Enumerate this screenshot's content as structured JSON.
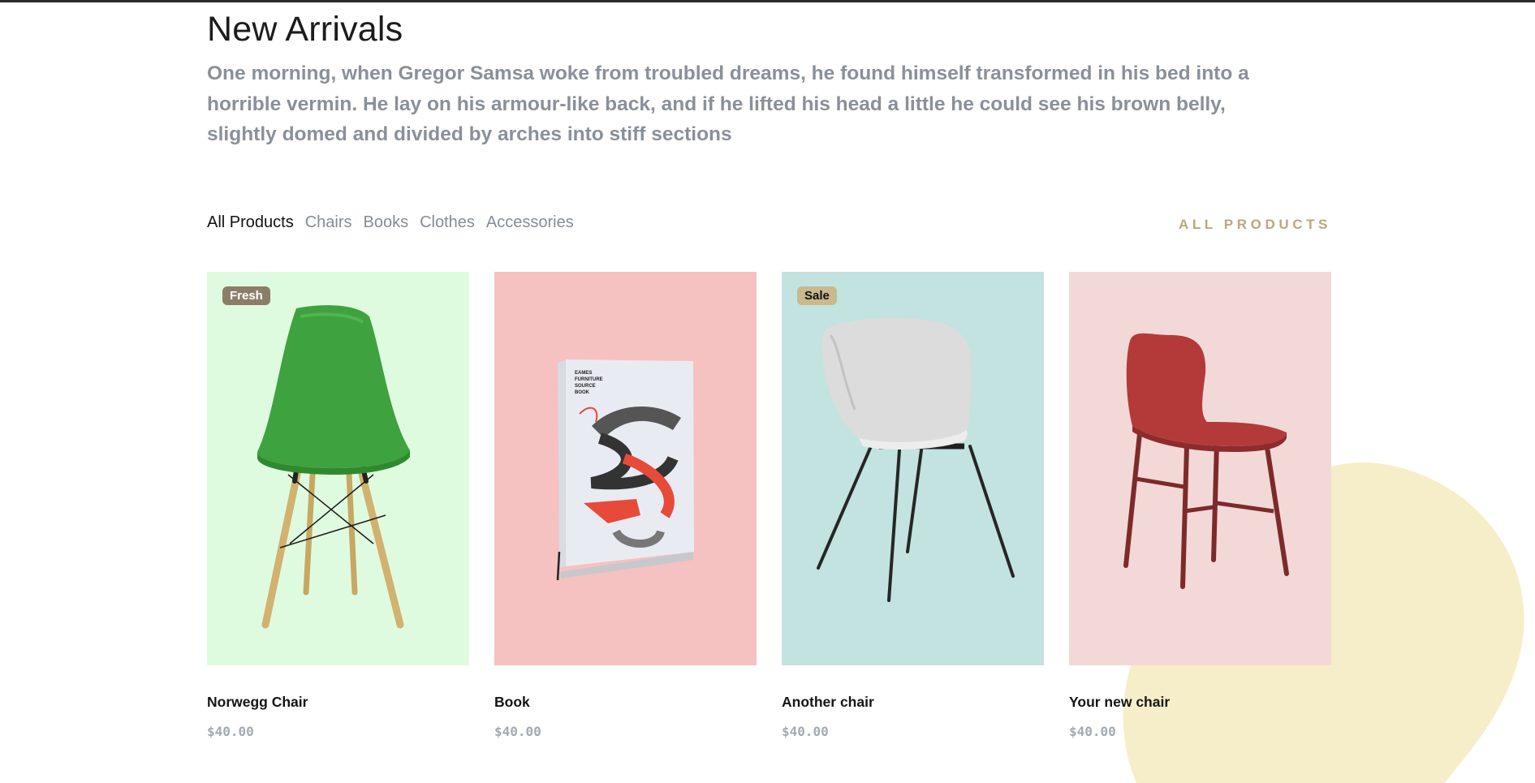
{
  "header": {
    "title": "New Arrivals",
    "description": "One morning, when Gregor Samsa woke from troubled dreams, he found himself transformed in his bed into a horrible vermin. He lay on his armour-like back, and if he lifted his head a little he could see his brown belly, slightly domed and divided by arches into stiff sections"
  },
  "filters": {
    "items": [
      {
        "label": "All Products",
        "active": true
      },
      {
        "label": "Chairs",
        "active": false
      },
      {
        "label": "Books",
        "active": false
      },
      {
        "label": "Clothes",
        "active": false
      },
      {
        "label": "Accessories",
        "active": false
      }
    ],
    "all_products_link": "ALL PRODUCTS"
  },
  "products": [
    {
      "name": "Norwegg Chair",
      "price": "$40.00",
      "badge": "Fresh",
      "badge_bg": "#8c7e66",
      "badge_color": "#ffffff",
      "bg": "#dffbdf",
      "icon": "green-chair-image"
    },
    {
      "name": "Book",
      "price": "$40.00",
      "badge": "",
      "bg": "#f6c1c1",
      "icon": "book-image"
    },
    {
      "name": "Another chair",
      "price": "$40.00",
      "badge": "Sale",
      "badge_bg": "#c9b98c",
      "badge_color": "#111111",
      "bg": "#c2e3e0",
      "icon": "white-chair-image"
    },
    {
      "name": "Your new chair",
      "price": "$40.00",
      "badge": "",
      "bg": "#f3d8d8",
      "icon": "red-chair-image"
    }
  ],
  "colors": {
    "accent": "#bba77c",
    "blob": "#f6eec9",
    "muted_text": "#8a9099"
  }
}
